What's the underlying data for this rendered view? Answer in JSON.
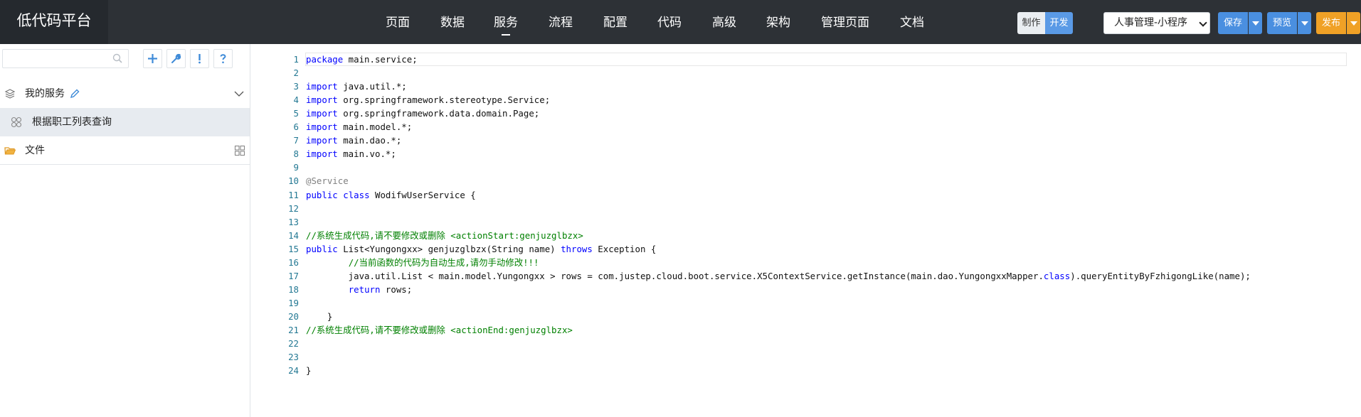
{
  "app": {
    "title": "低代码平台"
  },
  "nav": {
    "items": [
      {
        "label": "页面"
      },
      {
        "label": "数据"
      },
      {
        "label": "服务"
      },
      {
        "label": "流程"
      },
      {
        "label": "配置"
      },
      {
        "label": "代码"
      },
      {
        "label": "高级"
      },
      {
        "label": "架构"
      },
      {
        "label": "管理页面"
      },
      {
        "label": "文档"
      }
    ],
    "active": "服务"
  },
  "mode": {
    "make": "制作",
    "dev": "开发",
    "active": "开发"
  },
  "project": {
    "selected": "人事管理-小程序"
  },
  "actions": {
    "save": "保存",
    "preview": "预览",
    "publish": "发布"
  },
  "sidebar": {
    "search": {
      "value": "",
      "placeholder": ""
    },
    "tools": [
      {
        "glyph": "+",
        "icon": "add-icon"
      },
      {
        "glyph": "wrench",
        "icon": "wrench-icon"
      },
      {
        "glyph": "!",
        "icon": "exclamation-icon"
      },
      {
        "glyph": "?",
        "icon": "help-icon"
      }
    ],
    "tree": {
      "group": {
        "label": "我的服务",
        "icon": "layers-icon"
      },
      "item": {
        "label": "根据职工列表查询",
        "icon": "service-icon"
      },
      "files": {
        "label": "文件",
        "icon": "folder-open-icon"
      }
    }
  },
  "editor": {
    "lines": [
      [
        {
          "t": "package",
          "c": "kw"
        },
        {
          "t": " main.service;",
          "c": ""
        }
      ],
      [],
      [
        {
          "t": "import",
          "c": "kw"
        },
        {
          "t": " java.util.*;",
          "c": ""
        }
      ],
      [
        {
          "t": "import",
          "c": "kw"
        },
        {
          "t": " org.springframework.stereotype.Service;",
          "c": ""
        }
      ],
      [
        {
          "t": "import",
          "c": "kw"
        },
        {
          "t": " org.springframework.data.domain.Page;",
          "c": ""
        }
      ],
      [
        {
          "t": "import",
          "c": "kw"
        },
        {
          "t": " main.model.*;",
          "c": ""
        }
      ],
      [
        {
          "t": "import",
          "c": "kw"
        },
        {
          "t": " main.dao.*;",
          "c": ""
        }
      ],
      [
        {
          "t": "import",
          "c": "kw"
        },
        {
          "t": " main.vo.*;",
          "c": ""
        }
      ],
      [],
      [
        {
          "t": "@Service",
          "c": "an"
        }
      ],
      [
        {
          "t": "public",
          "c": "kw"
        },
        {
          "t": " ",
          "c": ""
        },
        {
          "t": "class",
          "c": "kw"
        },
        {
          "t": " WodifwUserService {",
          "c": ""
        }
      ],
      [],
      [],
      [
        {
          "t": "//系统生成代码,请不要修改或删除 <actionStart:genjuzglbzx>",
          "c": "cm"
        }
      ],
      [
        {
          "t": "public",
          "c": "kw"
        },
        {
          "t": " List<Yungongxx> genjuzglbzx(String name) ",
          "c": ""
        },
        {
          "t": "throws",
          "c": "kw"
        },
        {
          "t": " Exception {",
          "c": ""
        }
      ],
      [
        {
          "t": "        ",
          "c": ""
        },
        {
          "t": "//当前函数的代码为自动生成,请勿手动修改!!!",
          "c": "cm"
        }
      ],
      [
        {
          "t": "        java.util.List < main.model.Yungongxx > rows = com.justep.cloud.boot.service.X5ContextService.getInstance(main.dao.YungongxxMapper.",
          "c": ""
        },
        {
          "t": "class",
          "c": "kw"
        },
        {
          "t": ").queryEntityByFzhigongLike(name);",
          "c": ""
        }
      ],
      [
        {
          "t": "        ",
          "c": ""
        },
        {
          "t": "return",
          "c": "kw"
        },
        {
          "t": " rows;",
          "c": ""
        }
      ],
      [],
      [
        {
          "t": "    }",
          "c": ""
        }
      ],
      [
        {
          "t": "//系统生成代码,请不要修改或删除 <actionEnd:genjuzglbzx>",
          "c": "cm"
        }
      ],
      [],
      [],
      [
        {
          "t": "}",
          "c": ""
        }
      ]
    ]
  }
}
